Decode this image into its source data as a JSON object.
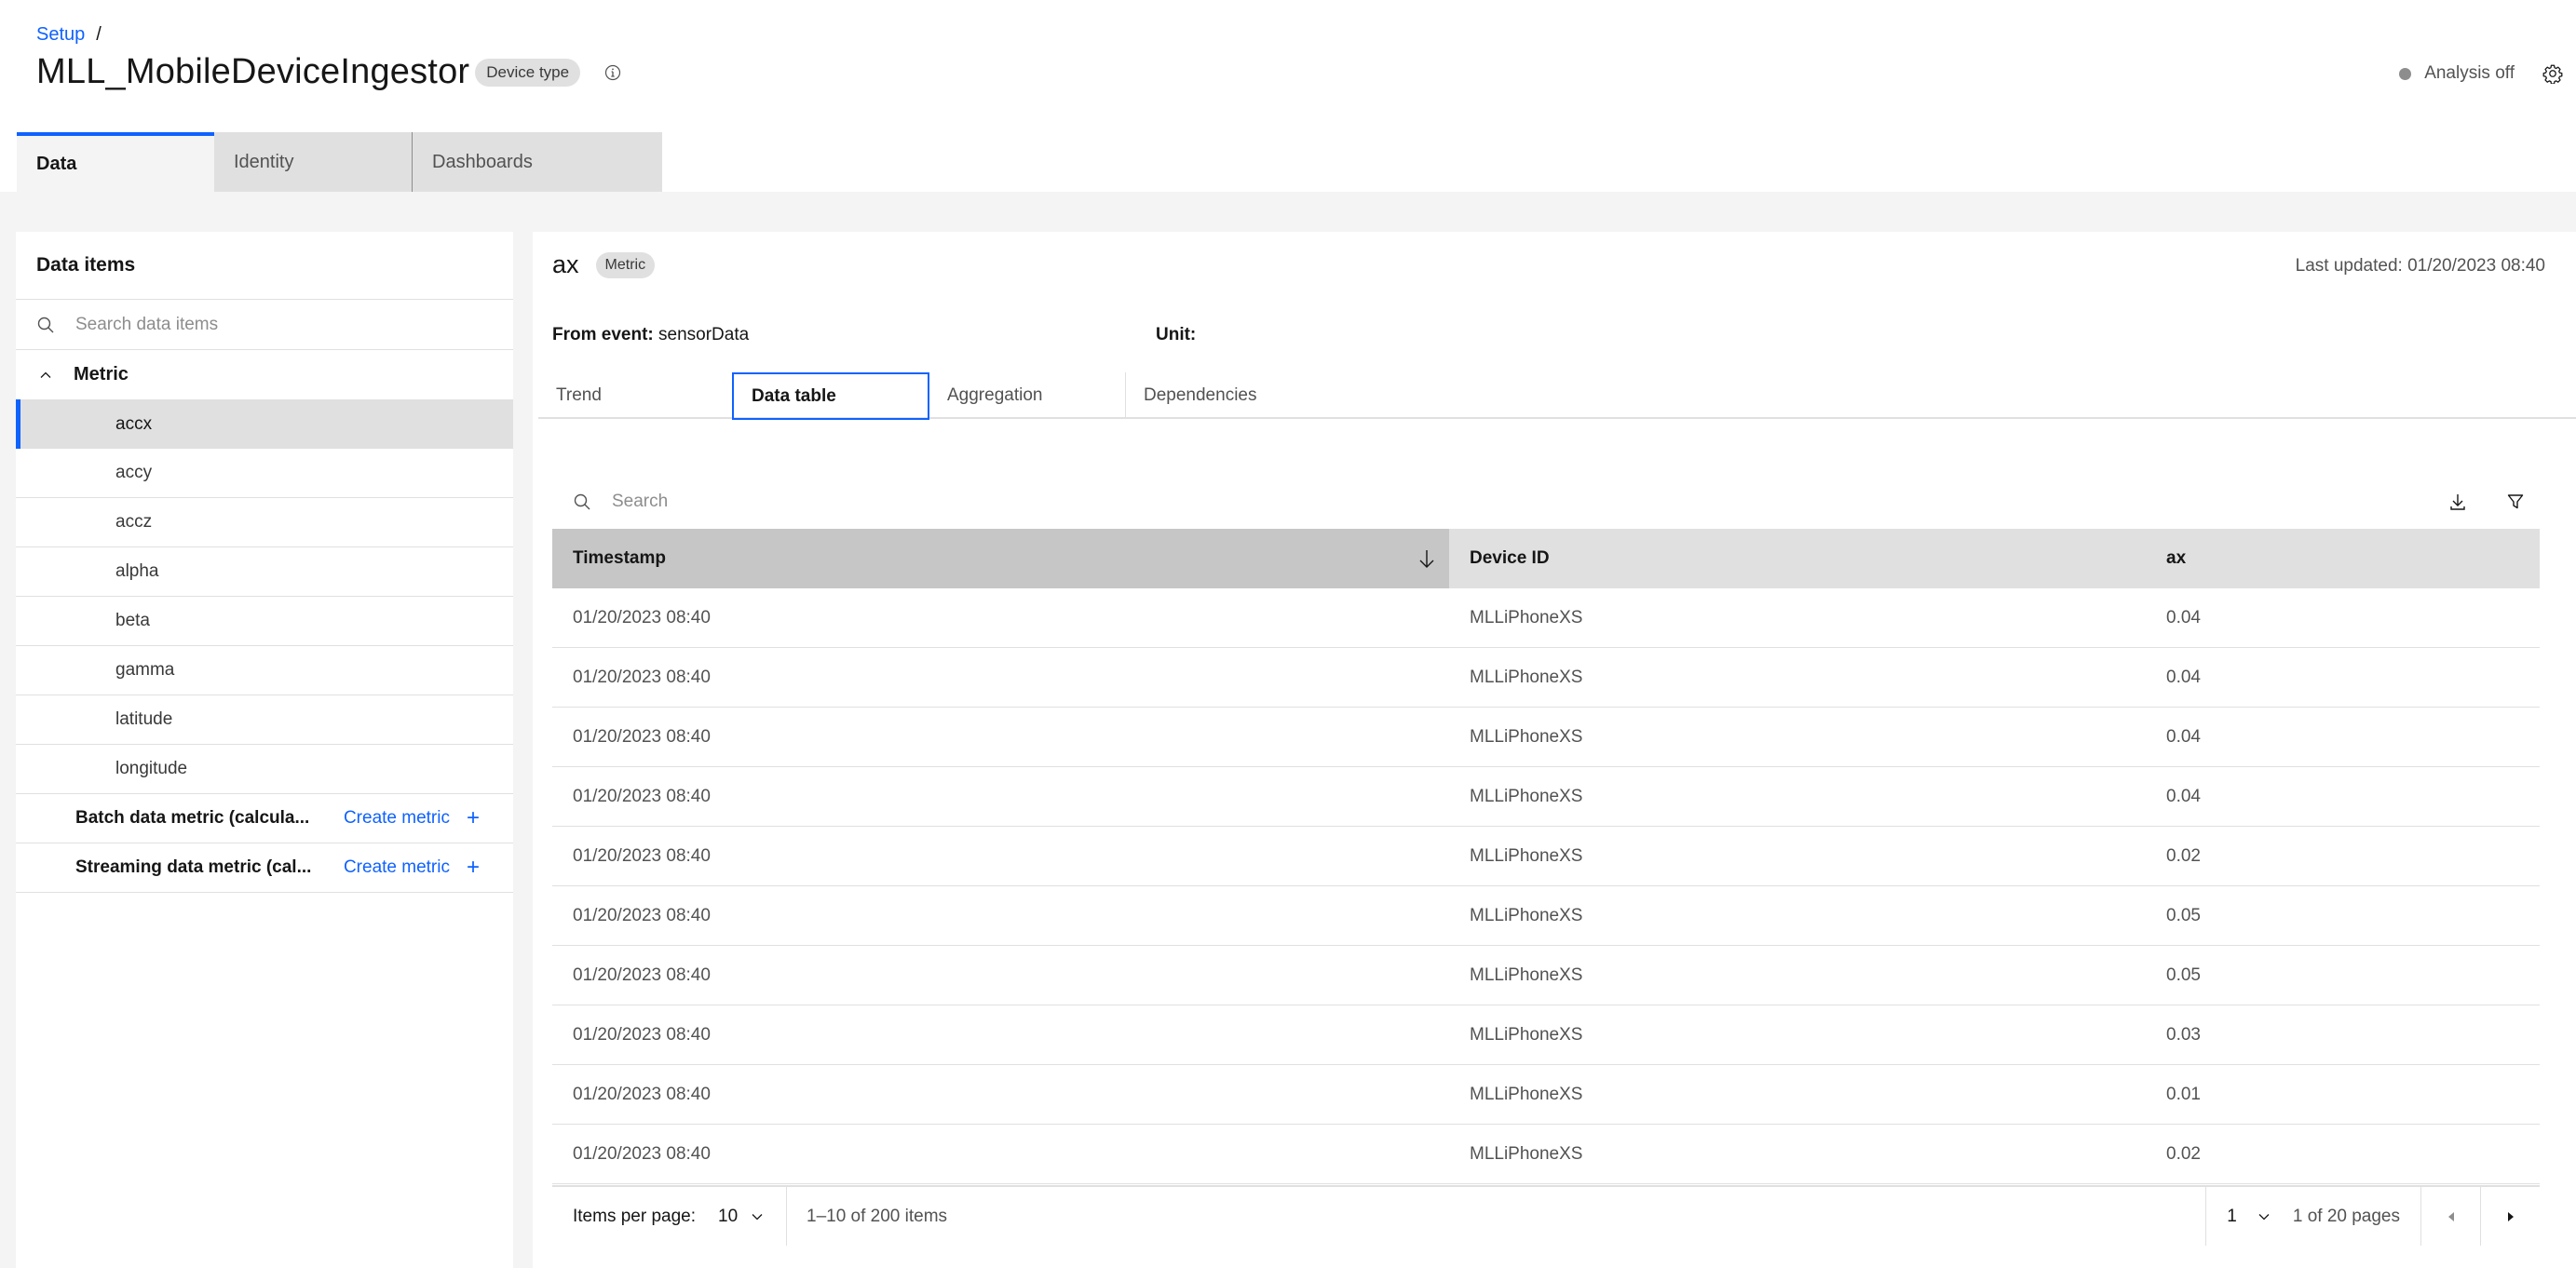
{
  "breadcrumb": {
    "link": "Setup",
    "separator": "/"
  },
  "header": {
    "title": "MLL_MobileDeviceIngestor",
    "tag": "Device type",
    "status": "Analysis off",
    "status_color": "#8d8d8d"
  },
  "tabs": [
    {
      "label": "Data",
      "active": true
    },
    {
      "label": "Identity",
      "active": false
    },
    {
      "label": "Dashboards",
      "active": false
    }
  ],
  "sidebar": {
    "title": "Data items",
    "search_placeholder": "Search data items",
    "group": "Metric",
    "items": [
      {
        "label": "accx",
        "selected": true
      },
      {
        "label": "accy"
      },
      {
        "label": "accz"
      },
      {
        "label": "alpha"
      },
      {
        "label": "beta"
      },
      {
        "label": "gamma"
      },
      {
        "label": "latitude"
      },
      {
        "label": "longitude"
      }
    ],
    "calculated": [
      {
        "label": "Batch data metric (calcula...",
        "action": "Create metric"
      },
      {
        "label": "Streaming data metric (cal...",
        "action": "Create metric"
      }
    ]
  },
  "detail": {
    "name": "ax",
    "tag": "Metric",
    "last_updated": "Last updated: 01/20/2023 08:40",
    "from_event_label": "From event:",
    "from_event_value": "sensorData",
    "unit_label": "Unit:",
    "unit_value": "",
    "tabs": [
      {
        "label": "Trend"
      },
      {
        "label": "Data table",
        "active": true
      },
      {
        "label": "Aggregation"
      },
      {
        "label": "Dependencies"
      }
    ]
  },
  "table": {
    "search_placeholder": "Search",
    "columns": [
      "Timestamp",
      "Device ID",
      "ax"
    ],
    "sorted_column": "Timestamp",
    "sort_direction": "descending",
    "rows": [
      [
        "01/20/2023 08:40",
        "MLLiPhoneXS",
        "0.04"
      ],
      [
        "01/20/2023 08:40",
        "MLLiPhoneXS",
        "0.04"
      ],
      [
        "01/20/2023 08:40",
        "MLLiPhoneXS",
        "0.04"
      ],
      [
        "01/20/2023 08:40",
        "MLLiPhoneXS",
        "0.04"
      ],
      [
        "01/20/2023 08:40",
        "MLLiPhoneXS",
        "0.02"
      ],
      [
        "01/20/2023 08:40",
        "MLLiPhoneXS",
        "0.05"
      ],
      [
        "01/20/2023 08:40",
        "MLLiPhoneXS",
        "0.05"
      ],
      [
        "01/20/2023 08:40",
        "MLLiPhoneXS",
        "0.03"
      ],
      [
        "01/20/2023 08:40",
        "MLLiPhoneXS",
        "0.01"
      ],
      [
        "01/20/2023 08:40",
        "MLLiPhoneXS",
        "0.02"
      ]
    ]
  },
  "pagination": {
    "items_per_page_label": "Items per page:",
    "items_per_page": "10",
    "range": "1–10 of 200 items",
    "page": "1",
    "page_of": "1 of 20 pages"
  },
  "colors": {
    "accent": "#0f62fe",
    "link": "#0f62fe"
  }
}
